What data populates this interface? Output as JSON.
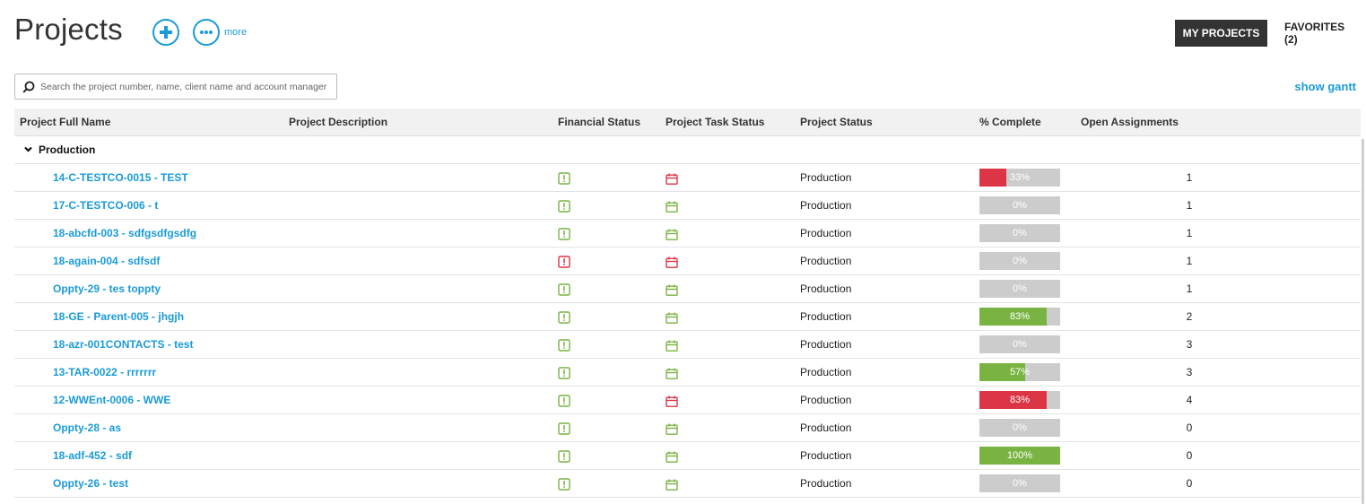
{
  "header": {
    "title": "Projects",
    "add_icon": "plus-circle-icon",
    "more_icon": "ellipsis-circle-icon",
    "more_label": "more"
  },
  "tabs": {
    "my_projects": "MY PROJECTS",
    "favorites": "FAVORITES (2)"
  },
  "search": {
    "placeholder": "Search the project number, name, client name and account manager",
    "value": ""
  },
  "show_gantt": "show gantt",
  "columns": {
    "name": "Project Full Name",
    "description": "Project Description",
    "financial": "Financial Status",
    "task": "Project Task Status",
    "status": "Project Status",
    "complete": "% Complete",
    "open": "Open Assignments"
  },
  "group": {
    "label": "Production"
  },
  "colors": {
    "accent": "#1a9bd7",
    "good": "#79b443",
    "bad": "#dc3545",
    "bar_bg": "#cccccc"
  },
  "rows": [
    {
      "name": "14-C-TESTCO-0015 - TEST",
      "fin": "good",
      "task": "bad",
      "status": "Production",
      "pct": 33,
      "pct_label": "33%",
      "bar": "bad",
      "open": "1"
    },
    {
      "name": "17-C-TESTCO-006 - t",
      "fin": "good",
      "task": "good",
      "status": "Production",
      "pct": 0,
      "pct_label": "0%",
      "bar": "none",
      "open": "1"
    },
    {
      "name": "18-abcfd-003 - sdfgsdfgsdfg",
      "fin": "good",
      "task": "good",
      "status": "Production",
      "pct": 0,
      "pct_label": "0%",
      "bar": "none",
      "open": "1"
    },
    {
      "name": "18-again-004 - sdfsdf",
      "fin": "bad",
      "task": "bad",
      "status": "Production",
      "pct": 0,
      "pct_label": "0%",
      "bar": "none",
      "open": "1"
    },
    {
      "name": "Oppty-29 - tes toppty",
      "fin": "good",
      "task": "good",
      "status": "Production",
      "pct": 0,
      "pct_label": "0%",
      "bar": "none",
      "open": "1"
    },
    {
      "name": "18-GE - Parent-005 - jhgjh",
      "fin": "good",
      "task": "good",
      "status": "Production",
      "pct": 83,
      "pct_label": "83%",
      "bar": "good",
      "open": "2"
    },
    {
      "name": "18-azr-001CONTACTS - test",
      "fin": "good",
      "task": "good",
      "status": "Production",
      "pct": 0,
      "pct_label": "0%",
      "bar": "none",
      "open": "3"
    },
    {
      "name": "13-TAR-0022 - rrrrrrr",
      "fin": "good",
      "task": "good",
      "status": "Production",
      "pct": 57,
      "pct_label": "57%",
      "bar": "good",
      "open": "3"
    },
    {
      "name": "12-WWEnt-0006 - WWE",
      "fin": "good",
      "task": "bad",
      "status": "Production",
      "pct": 83,
      "pct_label": "83%",
      "bar": "bad",
      "open": "4"
    },
    {
      "name": "Oppty-28 - as",
      "fin": "good",
      "task": "good",
      "status": "Production",
      "pct": 0,
      "pct_label": "0%",
      "bar": "none",
      "open": "0"
    },
    {
      "name": "18-adf-452 - sdf",
      "fin": "good",
      "task": "good",
      "status": "Production",
      "pct": 100,
      "pct_label": "100%",
      "bar": "good",
      "open": "0"
    },
    {
      "name": "Oppty-26 - test",
      "fin": "good",
      "task": "good",
      "status": "Production",
      "pct": 0,
      "pct_label": "0%",
      "bar": "none",
      "open": "0"
    }
  ]
}
